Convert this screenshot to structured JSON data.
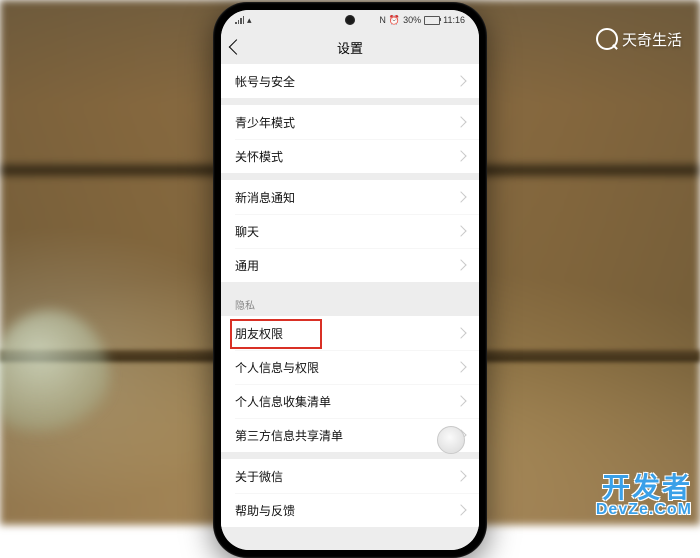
{
  "watermarks": {
    "tianqi": "天奇生活",
    "dev_cn": "开发者",
    "dev_en": "DevZe.CoM"
  },
  "statusbar": {
    "nfc": "N",
    "battery_pct": "30%",
    "battery_fill_pct": 30,
    "time": "11:16"
  },
  "header": {
    "title": "设置"
  },
  "groups": [
    {
      "items": [
        {
          "label": "帐号与安全"
        }
      ]
    },
    {
      "items": [
        {
          "label": "青少年模式"
        },
        {
          "label": "关怀模式"
        }
      ]
    },
    {
      "items": [
        {
          "label": "新消息通知"
        },
        {
          "label": "聊天"
        },
        {
          "label": "通用"
        }
      ]
    },
    {
      "title": "隐私",
      "items": [
        {
          "label": "朋友权限",
          "highlighted": true
        },
        {
          "label": "个人信息与权限"
        },
        {
          "label": "个人信息收集清单"
        },
        {
          "label": "第三方信息共享清单"
        }
      ]
    },
    {
      "items": [
        {
          "label": "关于微信"
        },
        {
          "label": "帮助与反馈"
        }
      ]
    }
  ]
}
